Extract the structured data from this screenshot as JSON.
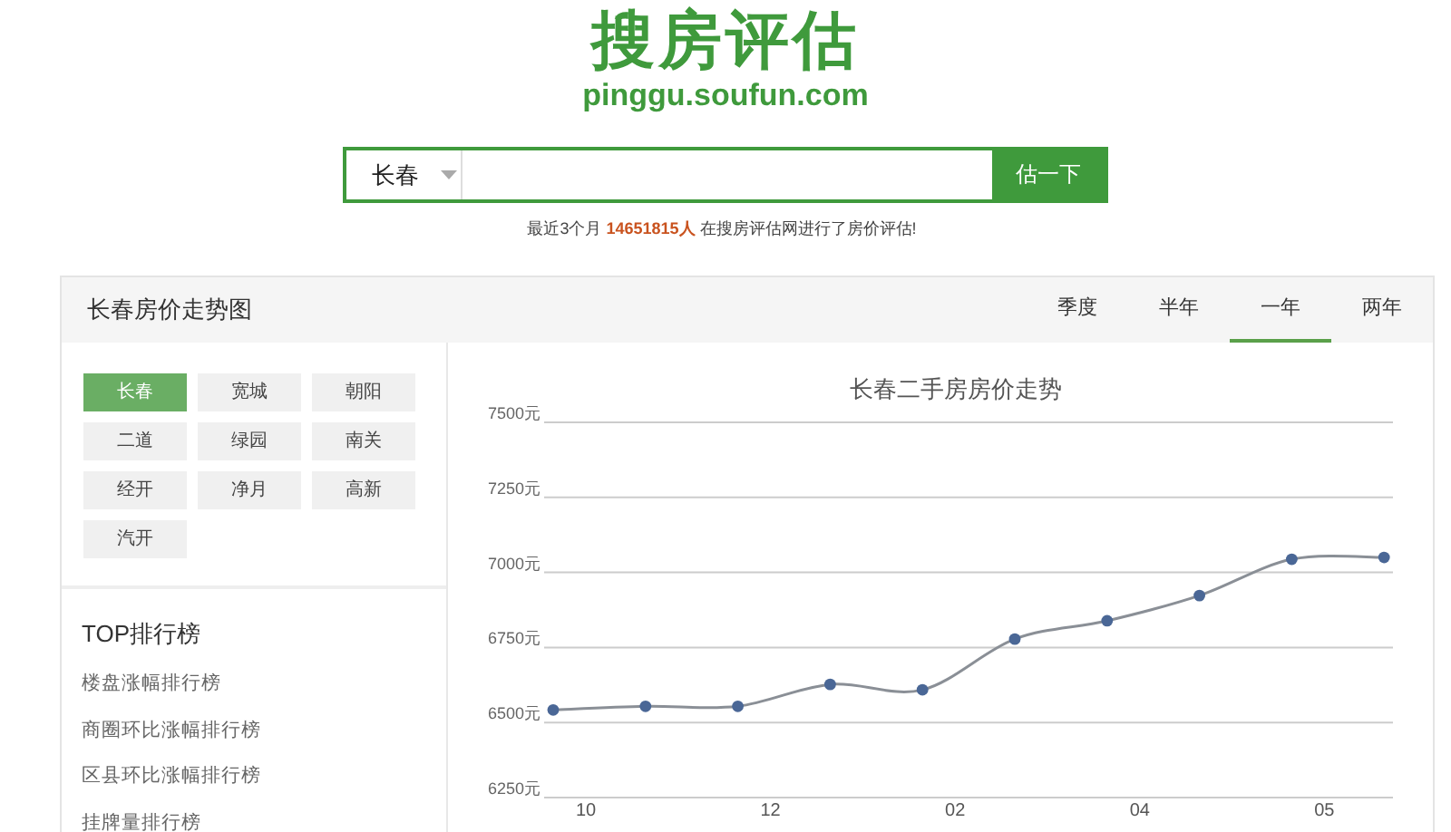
{
  "logo": {
    "title": "搜房评估",
    "url": "pinggu.soufun.com"
  },
  "search": {
    "city": "长春",
    "button": "估一下"
  },
  "notice": {
    "before": "最近3个月",
    "count": "14651815人",
    "after": "在搜房评估网进行了房价评估!"
  },
  "panel": {
    "title": "长春房价走势图",
    "tabs": [
      {
        "label": "季度",
        "selected": false
      },
      {
        "label": "半年",
        "selected": false
      },
      {
        "label": "一年",
        "selected": true
      },
      {
        "label": "两年",
        "selected": false
      }
    ],
    "districts": [
      {
        "label": "长春",
        "selected": true
      },
      {
        "label": "宽城",
        "selected": false
      },
      {
        "label": "朝阳",
        "selected": false
      },
      {
        "label": "二道",
        "selected": false
      },
      {
        "label": "绿园",
        "selected": false
      },
      {
        "label": "南关",
        "selected": false
      },
      {
        "label": "经开",
        "selected": false
      },
      {
        "label": "净月",
        "selected": false
      },
      {
        "label": "高新",
        "selected": false
      },
      {
        "label": "汽开",
        "selected": false
      }
    ],
    "rankings": {
      "title": "TOP排行榜",
      "items": [
        "楼盘涨幅排行榜",
        "商圈环比涨幅排行榜",
        "区县环比涨幅排行榜",
        "挂牌量排行榜"
      ]
    },
    "chart": {
      "chart_data": {
        "type": "line",
        "title": "长春二手房房价走势",
        "categories": [
          "10",
          null,
          "12",
          null,
          "02",
          null,
          "04",
          null,
          "05",
          null
        ],
        "grid": true,
        "series": [
          {
            "color": "#4a6796",
            "marker": true,
            "values": [
              6542,
              6554,
              6554,
              6627,
              6609,
              6778,
              6839,
              6923,
              7044,
              7050
            ]
          }
        ],
        "ylim": [
          6250,
          7500
        ],
        "yticks": [
          {
            "value": 7500,
            "label": "7500元"
          },
          {
            "value": 7250,
            "label": "7250元"
          },
          {
            "value": 7000,
            "label": "7000元"
          },
          {
            "value": 6750,
            "label": "6750元"
          },
          {
            "value": 6500,
            "label": "6500元"
          },
          {
            "value": 6250,
            "label": "6250元"
          }
        ]
      }
    }
  }
}
